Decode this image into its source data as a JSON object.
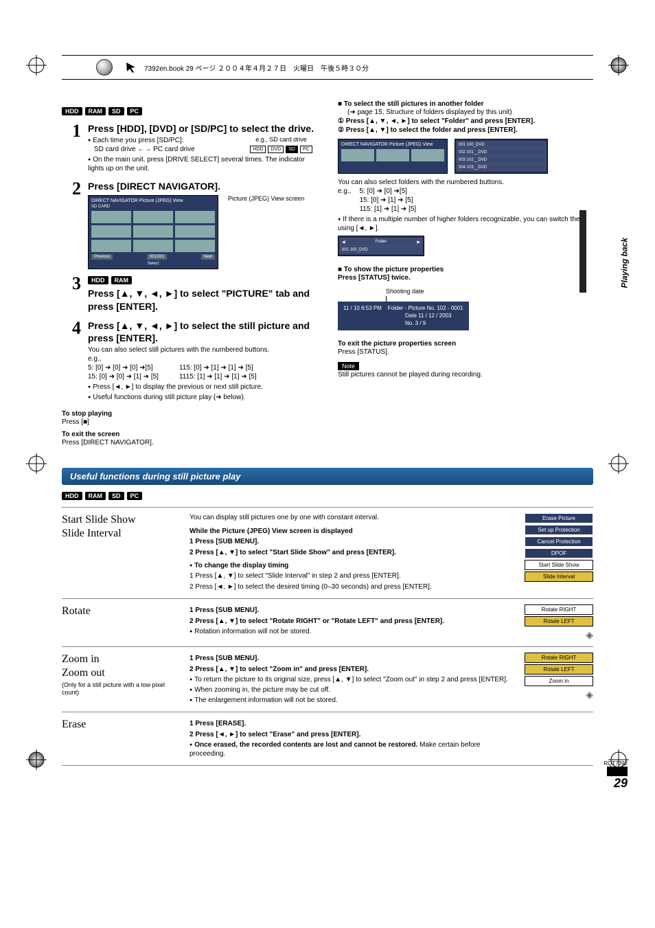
{
  "header": {
    "scribe": "7392en.book  29 ページ  ２００４年４月２７日　火曜日　午後５時３０分"
  },
  "badges": [
    "HDD",
    "RAM",
    "SD",
    "PC"
  ],
  "badges2": [
    "HDD",
    "RAM"
  ],
  "steps": {
    "s1": {
      "title": "Press [HDD], [DVD] or [SD/PC] to select the drive.",
      "b1": "Each time you press [SD/PC]:",
      "b1b": "SD card drive ←→ PC card drive",
      "b2": "On the main unit, press [DRIVE SELECT] several times. The indicator lights up on the unit.",
      "eg": "e.g., SD card drive",
      "drives": [
        "HDD",
        "DVD",
        "SD",
        "PC"
      ]
    },
    "s2": {
      "title": "Press [DIRECT NAVIGATOR].",
      "caption": "Picture (JPEG) View screen",
      "screen_title": "DIRECT NAVIGATOR    Picture (JPEG) View",
      "screen_sd": "SD CARD",
      "screen_btns": [
        "Previous",
        "001/001",
        "Next"
      ],
      "screen_foot": "Select"
    },
    "s3": {
      "title": "Press [▲, ▼, ◄, ►] to select \"PICTURE\" tab and press [ENTER]."
    },
    "s4": {
      "title": "Press [▲, ▼, ◄, ►] to select the still picture and press [ENTER].",
      "line1": "You can also select still pictures with the numbered buttons.",
      "eg": "e.g.,",
      "ex_a": "5:     [0] ➜ [0] ➜ [0] ➜[5]",
      "ex_b": "15:    [0] ➜ [0] ➜ [1] ➜ [5]",
      "ex_c": "115:   [0] ➜ [1] ➜ [1] ➜ [5]",
      "ex_d": "1115: [1] ➜ [1] ➜ [1] ➜ [5]",
      "b1": "Press [◄, ►] to display the previous or next still picture.",
      "b2": "Useful functions during still picture play (➜ below)."
    },
    "stop_h": "To stop playing",
    "stop_b": "Press [■]",
    "exit_h": "To exit the screen",
    "exit_b": "Press [DIRECT NAVIGATOR]."
  },
  "right": {
    "folder_h": "To select the still pictures in another folder",
    "folder_sub": "(➜ page 15, Structure of folders displayed by this unit)",
    "f1": "Press [▲, ▼, ◄, ►] to select \"Folder\" and press [ENTER].",
    "f2": "Press [▲, ▼] to select the folder and press [ENTER].",
    "folder_list": [
      "001 100_DVD",
      "002 101__DVD",
      "003 102__DVD",
      "004 103__DVD"
    ],
    "after1": "You can also select folders with the numbered buttons.",
    "after_eg": "e.g.,",
    "after_a": "5:      [0] ➜ [0] ➜[5]",
    "after_b": "15:     [0] ➜ [1] ➜ [5]",
    "after_c": "115:    [1] ➜ [1] ➜ [5]",
    "after2": "If there is a multiple number of higher folders recognizable, you can switch them using [◄, ►].",
    "switch_box": "001 100_DVD",
    "prop_h": "To show the picture properties",
    "prop_sub": "Press [STATUS] twice.",
    "shoot": "Shooting date",
    "prop_time": "11 / 10  6:53 PM",
    "prop_folder": "Folder - Picture No.   102 - 0001",
    "prop_date": "Date   11 / 12 / 2003",
    "prop_no": "No.      3 /   9",
    "exit_prop_h": "To exit the picture properties screen",
    "exit_prop_b": "Press [STATUS].",
    "note_label": "Note",
    "note": "Still pictures cannot be played during recording.",
    "side_tab": "Playing back"
  },
  "section_bar": "Useful functions during still picture play",
  "tbl": {
    "r1": {
      "left1": "Start Slide Show",
      "left2": "Slide Interval",
      "intro": "You can display still pictures one by one with constant interval.",
      "while": "While the Picture (JPEG) View screen is displayed",
      "i1": "1   Press [SUB MENU].",
      "i2": "2   Press [▲, ▼] to select \"Start Slide Show\" and press [ENTER].",
      "change_h": "To change the display timing",
      "c1": "1   Press [▲, ▼] to select \"Slide Interval\" in step 2 and press [ENTER].",
      "c2": "2   Press [◄, ►] to select the desired timing (0–30 seconds) and press [ENTER].",
      "menu": [
        "Erase Picture",
        "Set up Protection",
        "Cancel Protection",
        "DPOF",
        "Start Slide Show",
        "Slide Interval"
      ]
    },
    "r2": {
      "left": "Rotate",
      "i1": "1   Press [SUB MENU].",
      "i2": "2   Press [▲, ▼] to select \"Rotate RIGHT\" or \"Rotate LEFT\" and press [ENTER].",
      "b1": "Rotation information will not be stored.",
      "menu": [
        "Rotate RIGHT",
        "Rotate LEFT"
      ]
    },
    "r3": {
      "left1": "Zoom in",
      "left2": "Zoom out",
      "note": "(Only for a still picture with a low pixel count)",
      "i1": "1  Press [SUB MENU].",
      "i2": "2   Press [▲, ▼] to select \"Zoom in\" and press [ENTER].",
      "b1": "To return the picture to its original size, press [▲, ▼] to select \"Zoom out\" in step 2 and press [ENTER].",
      "b2": "When zooming in, the picture may be cut off.",
      "b3": "The enlargement information will not be stored.",
      "menu": [
        "Rotate RIGHT",
        "Rotate LEFT",
        "Zoom in"
      ]
    },
    "r4": {
      "left": "Erase",
      "i1": "1   Press [ERASE].",
      "i2": "2   Press [◄, ►] to select \"Erase\" and press [ENTER].",
      "b1a": "Once erased, the recorded contents are lost and cannot be restored.",
      "b1b": " Make certain before proceeding."
    }
  },
  "footer": {
    "code": "RQT7392",
    "page": "29"
  }
}
